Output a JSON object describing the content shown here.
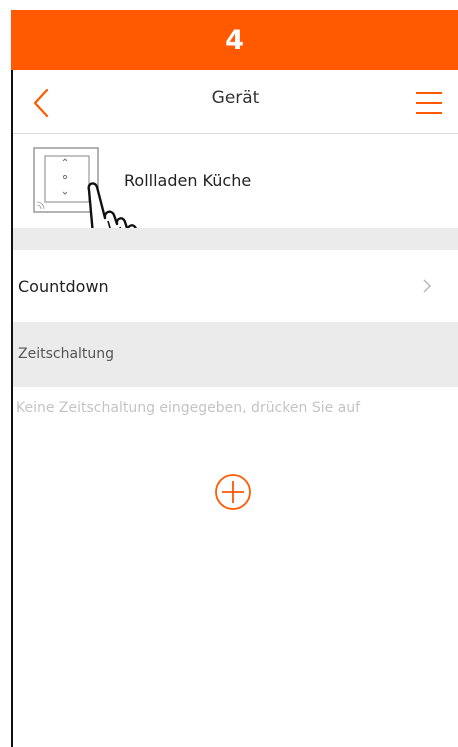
{
  "step": {
    "number": "4"
  },
  "appbar": {
    "title": "Gerät",
    "back_icon": "chevron-left-icon",
    "menu_icon": "hamburger-menu-icon"
  },
  "device": {
    "name": "Rollladen Küche",
    "thumbnail_icon": "shutter-switch-icon",
    "gesture_icon": "tap-hand-icon"
  },
  "countdown": {
    "label": "Countdown",
    "chevron_icon": "chevron-right-icon"
  },
  "timer_section": {
    "header": "Zeitschaltung",
    "empty_text": "Keine Zeitschaltung eingegeben, drücken Sie auf",
    "add_icon": "plus-circle-icon"
  },
  "colors": {
    "accent": "#ff5a00",
    "section_gray": "#ebebeb",
    "hint_gray": "#c4c4c4"
  }
}
